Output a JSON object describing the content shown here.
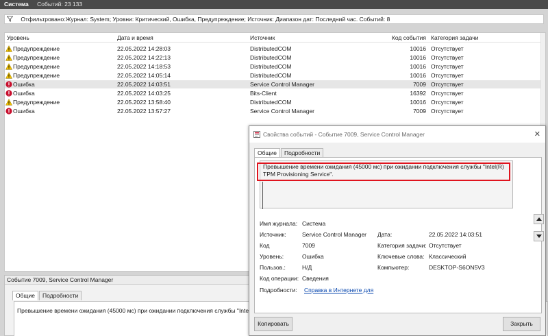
{
  "topbar": {
    "title": "Система",
    "count": "Событий: 23 133"
  },
  "filter": {
    "icon": "filter-icon",
    "text": "Отфильтровано:Журнал: System; Уровни: Критический, Ошибка, Предупреждение; Источник: Диапазон дат: Последний час. Событий: 8"
  },
  "table": {
    "headers": {
      "level": "Уровень",
      "date": "Дата и время",
      "source": "Источник",
      "code": "Код события",
      "category": "Категория задачи"
    },
    "rows": [
      {
        "type": "warning",
        "level": "Предупреждение",
        "date": "22.05.2022 14:28:03",
        "source": "DistributedCOM",
        "code": "10016",
        "category": "Отсутствует"
      },
      {
        "type": "warning",
        "level": "Предупреждение",
        "date": "22.05.2022 14:22:13",
        "source": "DistributedCOM",
        "code": "10016",
        "category": "Отсутствует"
      },
      {
        "type": "warning",
        "level": "Предупреждение",
        "date": "22.05.2022 14:18:53",
        "source": "DistributedCOM",
        "code": "10016",
        "category": "Отсутствует"
      },
      {
        "type": "warning",
        "level": "Предупреждение",
        "date": "22.05.2022 14:05:14",
        "source": "DistributedCOM",
        "code": "10016",
        "category": "Отсутствует"
      },
      {
        "type": "error",
        "level": "Ошибка",
        "date": "22.05.2022 14:03:51",
        "source": "Service Control Manager",
        "code": "7009",
        "category": "Отсутствует",
        "selected": true
      },
      {
        "type": "error",
        "level": "Ошибка",
        "date": "22.05.2022 14:03:25",
        "source": "Bits-Client",
        "code": "16392",
        "category": "Отсутствует"
      },
      {
        "type": "warning",
        "level": "Предупреждение",
        "date": "22.05.2022 13:58:40",
        "source": "DistributedCOM",
        "code": "10016",
        "category": "Отсутствует"
      },
      {
        "type": "error",
        "level": "Ошибка",
        "date": "22.05.2022 13:57:27",
        "source": "Service Control Manager",
        "code": "7009",
        "category": "Отсутствует"
      }
    ]
  },
  "bottom_panel": {
    "title": "Событие 7009, Service Control Manager",
    "tabs": [
      "Общие",
      "Подробности"
    ],
    "message": "Превышение времени ожидания (45000 мс) при ожидании подключения службы \"Intel"
  },
  "dialog": {
    "title": "Свойства событий - Событие 7009, Service Control Manager",
    "close": "✕",
    "tabs": [
      "Общие",
      "Подробности"
    ],
    "message": "Превышение времени ожидания (45000 мс) при ожидании подключения службы \"Intel(R) TPM Provisioning Service\".",
    "labels": {
      "log_name": "Имя журнала:",
      "source": "Источник:",
      "code": "Код",
      "level": "Уровень:",
      "user": "Пользов.:",
      "opcode": "Код операции:",
      "more_info": "Подробности:",
      "date": "Дата:",
      "task_category": "Категория задачи:",
      "keywords": "Ключевые слова:",
      "computer": "Компьютер:"
    },
    "values": {
      "log_name": "Система",
      "source": "Service Control Manager",
      "code": "7009",
      "level": "Ошибка",
      "user": "Н/Д",
      "opcode": "Сведения",
      "more_info": "Справка в Интернете для",
      "date": "22.05.2022 14:03:51",
      "task_category": "Отсутствует",
      "keywords": "Классический",
      "computer": "DESKTOP-S6ON5V3"
    },
    "copy_button": "Копировать",
    "close_button": "Закрыть"
  },
  "colors": {
    "highlight": "#e0141e",
    "link": "#0645ad",
    "warning": "#f2c200",
    "error": "#c8102e"
  }
}
